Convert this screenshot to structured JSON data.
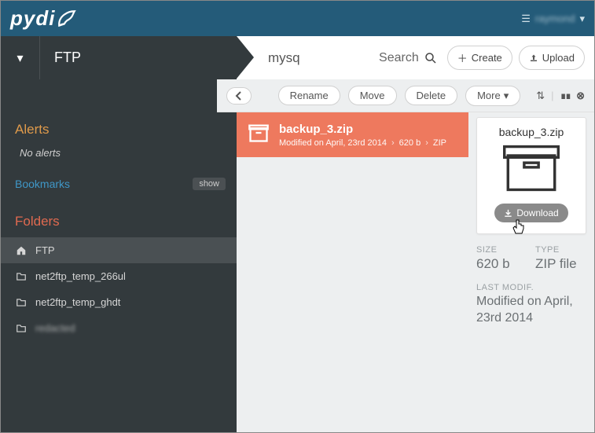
{
  "header": {
    "logo_text": "pydi",
    "username": "raymond"
  },
  "workspace": {
    "label": "FTP"
  },
  "breadcrumb": {
    "path": "mysq"
  },
  "search": {
    "label": "Search"
  },
  "topbuttons": {
    "create": "Create",
    "upload": "Upload"
  },
  "toolbar": {
    "rename": "Rename",
    "move": "Move",
    "delete": "Delete",
    "more": "More"
  },
  "sidebar": {
    "alerts_label": "Alerts",
    "no_alerts": "No alerts",
    "bookmarks_label": "Bookmarks",
    "show_label": "show",
    "folders_label": "Folders",
    "tree": [
      {
        "label": "FTP",
        "icon": "home"
      },
      {
        "label": "net2ftp_temp_266ul",
        "icon": "folder"
      },
      {
        "label": "net2ftp_temp_ghdt",
        "icon": "folder"
      },
      {
        "label": "redacted",
        "icon": "folder",
        "blurred": true
      }
    ]
  },
  "file": {
    "name": "backup_3.zip",
    "modified_line": "Modified on April, 23rd 2014",
    "size": "620 b",
    "type_short": "ZIP"
  },
  "detail": {
    "download": "Download",
    "size_label": "SIZE",
    "type_label": "TYPE",
    "type_value": "ZIP file",
    "lastmod_label": "LAST MODIF.",
    "lastmod_value": "Modified on April, 23rd 2014"
  }
}
